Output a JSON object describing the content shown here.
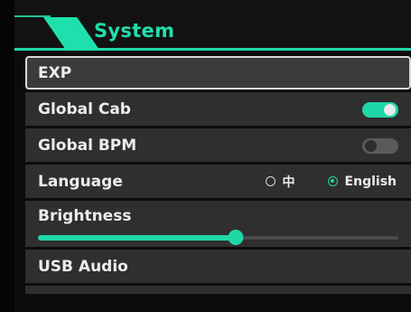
{
  "header": {
    "title": "System",
    "accent_color": "#1fd7a7"
  },
  "menu": {
    "items": [
      {
        "label": "EXP",
        "selected": true
      },
      {
        "label": "Global Cab",
        "toggle": "on"
      },
      {
        "label": "Global BPM",
        "toggle": "off"
      },
      {
        "label": "Language",
        "options": [
          "中",
          "English"
        ],
        "selected_option": "English"
      },
      {
        "label": "Brightness",
        "level_fraction": 0.55
      },
      {
        "label": "USB Audio"
      }
    ]
  }
}
